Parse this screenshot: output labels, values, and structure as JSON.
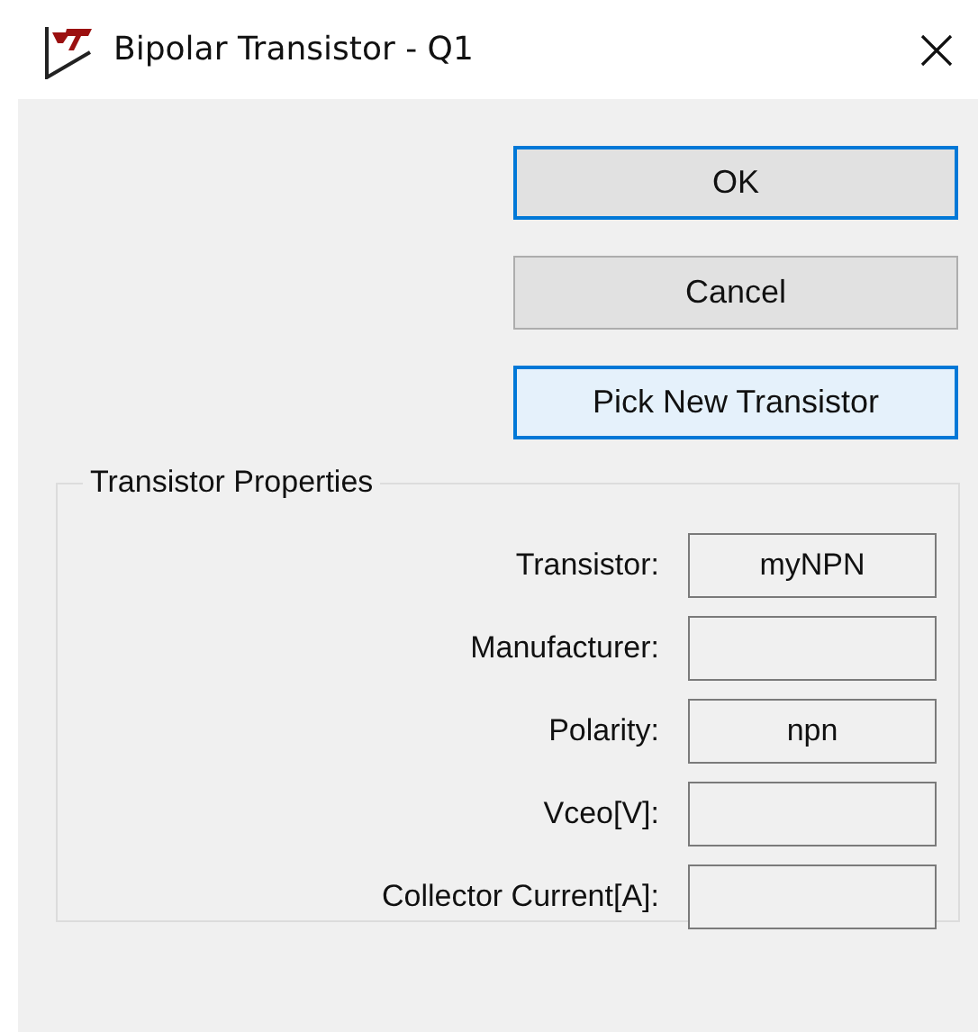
{
  "window": {
    "title": "Bipolar Transistor - Q1"
  },
  "buttons": [
    {
      "label": "OK",
      "kind": "default"
    },
    {
      "label": "Cancel",
      "kind": "normal"
    },
    {
      "label": "Pick New Transistor",
      "kind": "hot"
    }
  ],
  "group": {
    "title": "Transistor Properties",
    "fields": [
      {
        "label": "Transistor:",
        "value": "myNPN"
      },
      {
        "label": "Manufacturer:"
      },
      {
        "label": "Polarity:",
        "value": "npn"
      },
      {
        "label": "Vceo[V]:"
      },
      {
        "label": "Collector Current[A]:"
      }
    ]
  }
}
